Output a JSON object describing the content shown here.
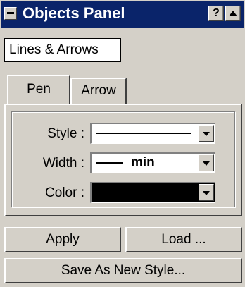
{
  "title_bar": {
    "title": "Objects Panel",
    "help_label": "?"
  },
  "category": "Lines & Arrows",
  "tabs": [
    {
      "label": "Pen",
      "selected": true
    },
    {
      "label": "Arrow",
      "selected": false
    }
  ],
  "pen": {
    "style": {
      "label": "Style :"
    },
    "width": {
      "label": "Width :",
      "value": "min"
    },
    "color": {
      "label": "Color :",
      "value": "#000000"
    }
  },
  "buttons": {
    "apply": "Apply",
    "load": "Load ...",
    "save_as": "Save As New Style..."
  }
}
